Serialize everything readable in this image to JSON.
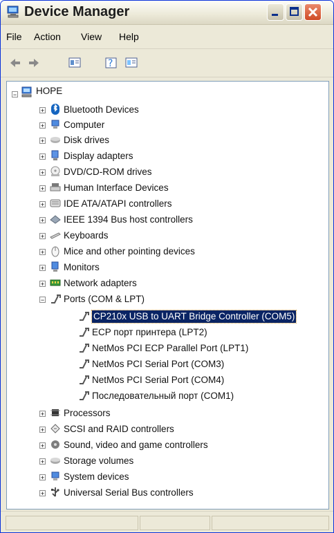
{
  "window": {
    "title": "Device Manager"
  },
  "menu": {
    "file": "File",
    "action": "Action",
    "view": "View",
    "help": "Help"
  },
  "tree": {
    "root": "HOPE",
    "categories": [
      "Bluetooth Devices",
      "Computer",
      "Disk drives",
      "Display adapters",
      "DVD/CD-ROM drives",
      "Human Interface Devices",
      "IDE ATA/ATAPI controllers",
      "IEEE 1394 Bus host controllers",
      "Keyboards",
      "Mice and other pointing devices",
      "Monitors",
      "Network adapters",
      "Ports (COM & LPT)"
    ],
    "ports": [
      "CP210x USB to UART Bridge Controller (COM5)",
      "ECP порт принтера (LPT2)",
      "NetMos PCI ECP Parallel Port (LPT1)",
      "NetMos PCI Serial Port (COM3)",
      "NetMos PCI Serial Port (COM4)",
      "Последовательный порт (COM1)"
    ],
    "more_categories": [
      "Processors",
      "SCSI and RAID controllers",
      "Sound, video and game controllers",
      "Storage volumes",
      "System devices",
      "Universal Serial Bus controllers"
    ]
  },
  "icons": {
    "app": "computer-icon",
    "toolbar": [
      "back-icon",
      "forward-icon",
      "properties-icon",
      "help-icon",
      "show-hide-icon"
    ]
  },
  "colors": {
    "selection": "#0a2464",
    "title_text": "#1d1d1d",
    "window_bg": "#ece9d8"
  }
}
